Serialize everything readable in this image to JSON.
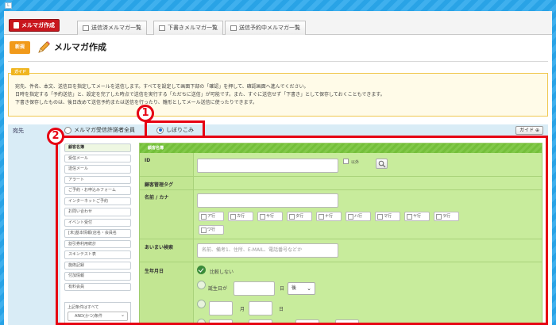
{
  "window": {
    "icon_label": "L"
  },
  "tabs": {
    "app_tab_label": "メルマガ作成",
    "nav": [
      {
        "label": "送信済メルマガ一覧"
      },
      {
        "label": "下書きメルマガ一覧"
      },
      {
        "label": "送信予約中メルマガ一覧"
      }
    ]
  },
  "header": {
    "new_badge": "新規",
    "title": "メルマガ作成"
  },
  "guide": {
    "label": "ガイド",
    "lines": [
      "宛先、件名、本文、送信日を指定してメールを送信します。すべてを設定して画面下部の「確認」を押して、確認画面へ進んでください。",
      "日時を指定する「予約送信」と、設定を完了した時点で送信を実行する「ただちに送信」が可能です。また、すぐに送信せず「下書き」として保存しておくこともできます。",
      "下書き保存したものは、後日改めて送信予約または送信を行ったり、雛形としてメール送信に使ったりできます。"
    ]
  },
  "recipient": {
    "label": "宛先",
    "option_all": "メルマガ受信許諾者全員",
    "option_filter": "しぼりこみ",
    "guide_button": "ガイド ⊕"
  },
  "markers": {
    "one": "1",
    "two": "2"
  },
  "categories": [
    {
      "label": "顧客名簿",
      "active": true
    },
    {
      "label": "受信メール"
    },
    {
      "label": "送信メール"
    },
    {
      "label": "アラート"
    },
    {
      "label": "ご予約・お申込みフォーム"
    },
    {
      "label": "インターネットご予約"
    },
    {
      "label": "お問い合わせ"
    },
    {
      "label": "イベント受付"
    },
    {
      "label": "[未]基本情報(店名・会員名"
    },
    {
      "label": "割引券利用統計"
    },
    {
      "label": "スキンテスト表"
    },
    {
      "label": "施術記録"
    },
    {
      "label": "付加情報"
    },
    {
      "label": "有料会員"
    }
  ],
  "condition": {
    "caption": "上記条件はすべて",
    "select_value": "AND(かつ)条件"
  },
  "form": {
    "head": "顧客名簿",
    "id_label": "ID",
    "exclude_label": "以外",
    "tag_label": "顧客管理タグ",
    "name_label": "名前 / カナ",
    "kana": [
      "ア行",
      "カ行",
      "サ行",
      "タ行",
      "ナ行",
      "ハ行",
      "マ行",
      "ヤ行",
      "ラ行",
      "ワ行"
    ],
    "fuzzy_label": "あいまい検索",
    "fuzzy_placeholder": "名前、備考1、住所、E-MAIL、電話番号などか",
    "birth_label": "生年月日",
    "no_compare": "比較しない",
    "birth_day_text": "誕生日が",
    "day_unit": "日",
    "after_value": "後",
    "month_unit": "月",
    "range_sep": "日〜"
  },
  "colors": {
    "accent_red": "#e60012",
    "app_tab_red": "#c8161d",
    "form_green": "#c8ec9c",
    "head_green": "#74bf3a",
    "badge_orange": "#f19a1b"
  }
}
